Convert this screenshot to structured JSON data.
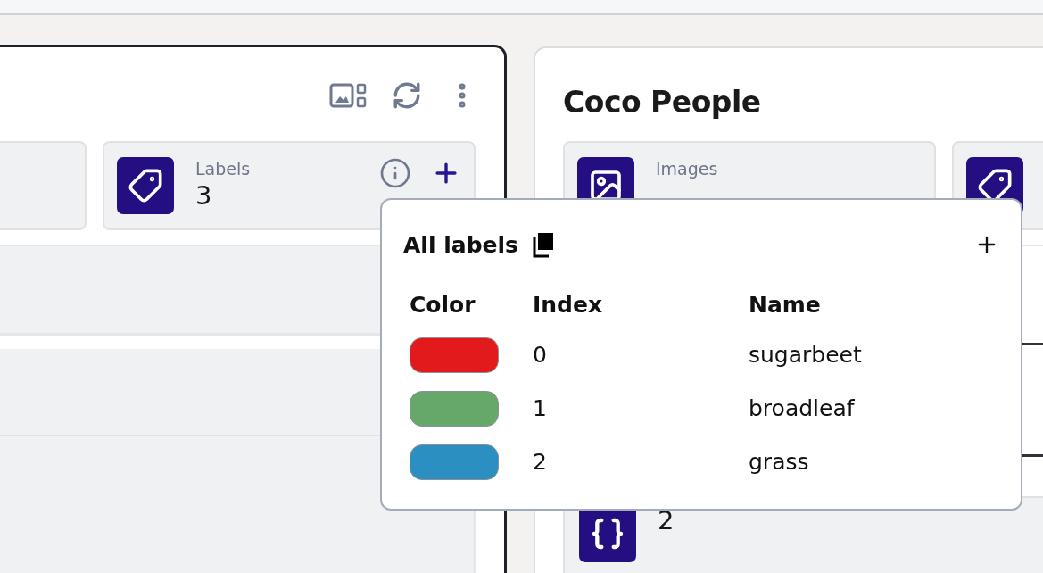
{
  "cards": [
    {
      "selected": true,
      "stats": [
        {
          "kind": "blank"
        },
        {
          "kind": "labels",
          "label": "Labels",
          "value": "3"
        }
      ]
    },
    {
      "selected": false,
      "title": "Coco People",
      "stats": [
        {
          "kind": "images",
          "label": "Images"
        },
        {
          "kind": "labels"
        }
      ],
      "lower_stat": {
        "kind": "annotation_sets",
        "value": "2"
      }
    }
  ],
  "popover": {
    "title": "All labels",
    "columns": [
      "Color",
      "Index",
      "Name"
    ],
    "rows": [
      {
        "color": "#e31a1c",
        "index": "0",
        "name": "sugarbeet"
      },
      {
        "color": "#66a86a",
        "index": "1",
        "name": "broadleaf"
      },
      {
        "color": "#2b8fc2",
        "index": "2",
        "name": "grass"
      }
    ]
  }
}
